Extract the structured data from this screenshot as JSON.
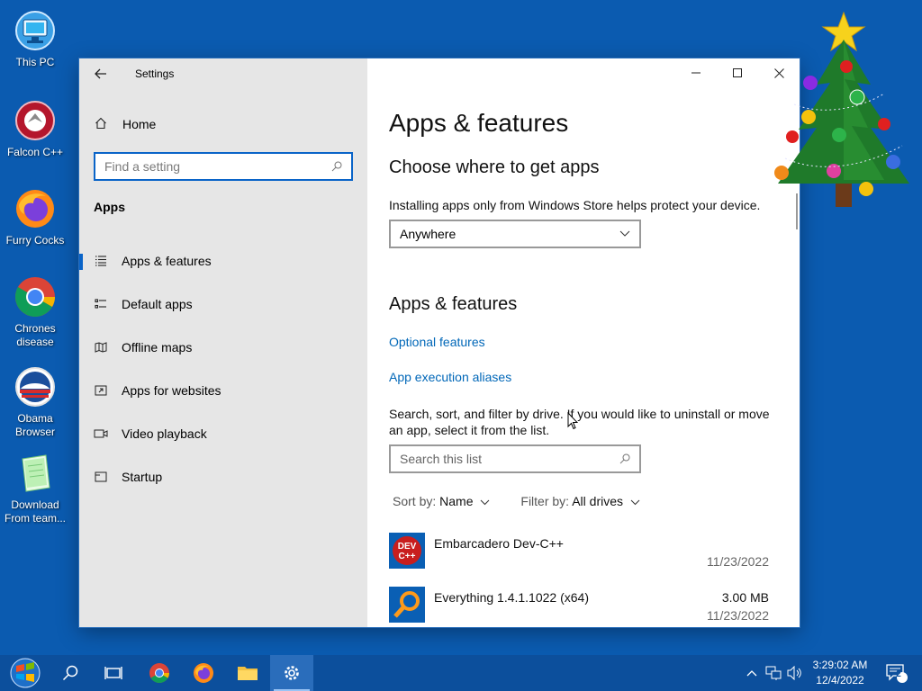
{
  "desktop": {
    "icons": [
      {
        "label": "This PC"
      },
      {
        "label": "Falcon C++"
      },
      {
        "label": "Furry Cocks"
      },
      {
        "label": "Chrones disease"
      },
      {
        "label": "Obama Browser"
      },
      {
        "label": "Download From team..."
      }
    ]
  },
  "window": {
    "title": "Settings",
    "nav": {
      "home": "Home",
      "search_placeholder": "Find a setting",
      "section": "Apps",
      "items": [
        {
          "label": "Apps & features",
          "icon": "apps-list-icon",
          "active": true
        },
        {
          "label": "Default apps",
          "icon": "default-apps-icon"
        },
        {
          "label": "Offline maps",
          "icon": "map-icon"
        },
        {
          "label": "Apps for websites",
          "icon": "web-apps-icon"
        },
        {
          "label": "Video playback",
          "icon": "video-icon"
        },
        {
          "label": "Startup",
          "icon": "startup-icon"
        }
      ]
    },
    "content": {
      "page_title": "Apps & features",
      "choose_heading": "Choose where to get apps",
      "choose_desc": "Installing apps only from Windows Store helps protect your device.",
      "source_value": "Anywhere",
      "features_heading": "Apps & features",
      "link_optional": "Optional features",
      "link_aliases": "App execution aliases",
      "search_desc": "Search, sort, and filter by drive. If you would like to uninstall or move an app, select it from the list.",
      "list_search_placeholder": "Search this list",
      "sort_label": "Sort by:",
      "sort_value": "Name",
      "filter_label": "Filter by:",
      "filter_value": "All drives",
      "apps": [
        {
          "name": "Embarcadero Dev-C++",
          "size": "",
          "date": "11/23/2022",
          "logo_text": "DEV C++"
        },
        {
          "name": "Everything 1.4.1.1022 (x64)",
          "size": "3.00 MB",
          "date": "11/23/2022"
        }
      ]
    }
  },
  "taskbar": {
    "time": "3:29:02 AM",
    "date": "12/4/2022",
    "notification_count": "2"
  },
  "colors": {
    "desktop": "#0b5bb0",
    "accent": "#0a64c8",
    "link": "#0067b8",
    "taskbar": "#0c4f9c"
  }
}
